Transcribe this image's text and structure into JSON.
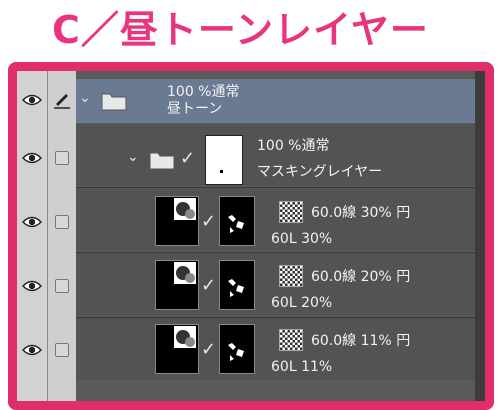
{
  "title": "C／昼トーンレイヤー",
  "layers": {
    "folder1": {
      "blend": "100 %通常",
      "name": "昼トーン"
    },
    "folder2": {
      "blend": "100 %通常",
      "name": "マスキングレイヤー"
    },
    "tone1": {
      "info": "60.0線 30% 円",
      "name": "60L 30%"
    },
    "tone2": {
      "info": "60.0線 20% 円",
      "name": "60L 20%"
    },
    "tone3": {
      "info": "60.0線 11% 円",
      "name": "60L 11%"
    }
  },
  "icons": {
    "eye": "eye-icon",
    "pen": "pen-icon",
    "lock": "lock-checkbox",
    "folder": "folder-icon",
    "chevron": "chevron-down-icon",
    "check": "checkmark-icon",
    "tone": "tone-pattern-icon"
  },
  "colors": {
    "accent": "#e02e6a",
    "title": "#e8357e",
    "selected": "#6b7a93"
  }
}
